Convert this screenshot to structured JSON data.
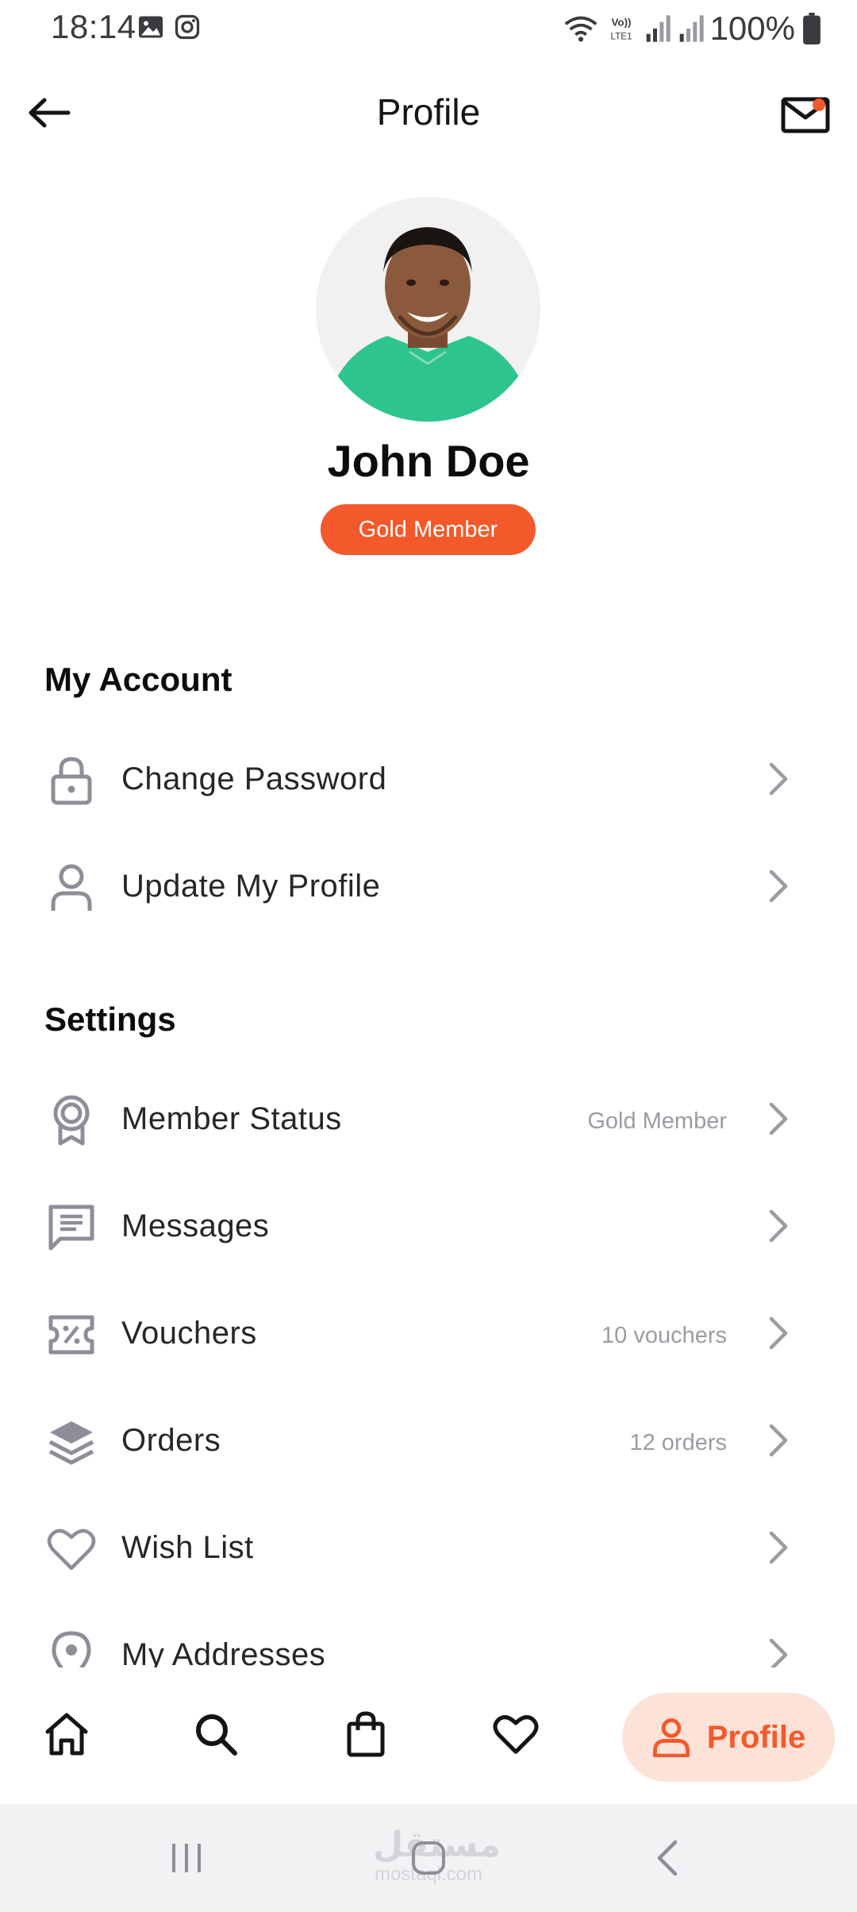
{
  "status_bar": {
    "time": "18:14",
    "battery": "100%",
    "left_icons": [
      "gallery-icon",
      "instagram-icon"
    ],
    "right_icons": [
      "wifi-icon",
      "volte-icon",
      "signal-icon",
      "signal-icon",
      "battery-icon"
    ]
  },
  "header": {
    "title": "Profile",
    "back_icon": "arrow-left-icon",
    "mail_icon": "mail-icon",
    "has_unread_dot": true
  },
  "profile": {
    "name": "John Doe",
    "badge": "Gold Member"
  },
  "sections": [
    {
      "heading": "My Account",
      "items": [
        {
          "icon": "lock-icon",
          "label": "Change Password",
          "detail": ""
        },
        {
          "icon": "user-icon",
          "label": "Update My Profile",
          "detail": ""
        }
      ]
    },
    {
      "heading": "Settings",
      "items": [
        {
          "icon": "award-icon",
          "label": "Member Status",
          "detail": "Gold Member"
        },
        {
          "icon": "message-icon",
          "label": "Messages",
          "detail": ""
        },
        {
          "icon": "voucher-icon",
          "label": "Vouchers",
          "detail": "10 vouchers"
        },
        {
          "icon": "layers-icon",
          "label": "Orders",
          "detail": "12 orders"
        },
        {
          "icon": "heart-icon",
          "label": "Wish List",
          "detail": ""
        },
        {
          "icon": "location-pin-icon",
          "label": "My Addresses",
          "detail": ""
        }
      ]
    }
  ],
  "bottom_nav": {
    "items": [
      {
        "icon": "home-icon"
      },
      {
        "icon": "search-icon"
      },
      {
        "icon": "shopping-bag-icon"
      },
      {
        "icon": "heart-icon"
      }
    ],
    "active": {
      "icon": "user-icon",
      "label": "Profile"
    }
  },
  "colors": {
    "accent": "#f4592b",
    "accent_soft": "#fde2d8",
    "icon_gray": "#8e8e98",
    "chevron_gray": "#9b9ba3",
    "avatar_shirt": "#2ec48d"
  },
  "watermark": {
    "text": "مستقل",
    "sub": "mostaql.com"
  }
}
